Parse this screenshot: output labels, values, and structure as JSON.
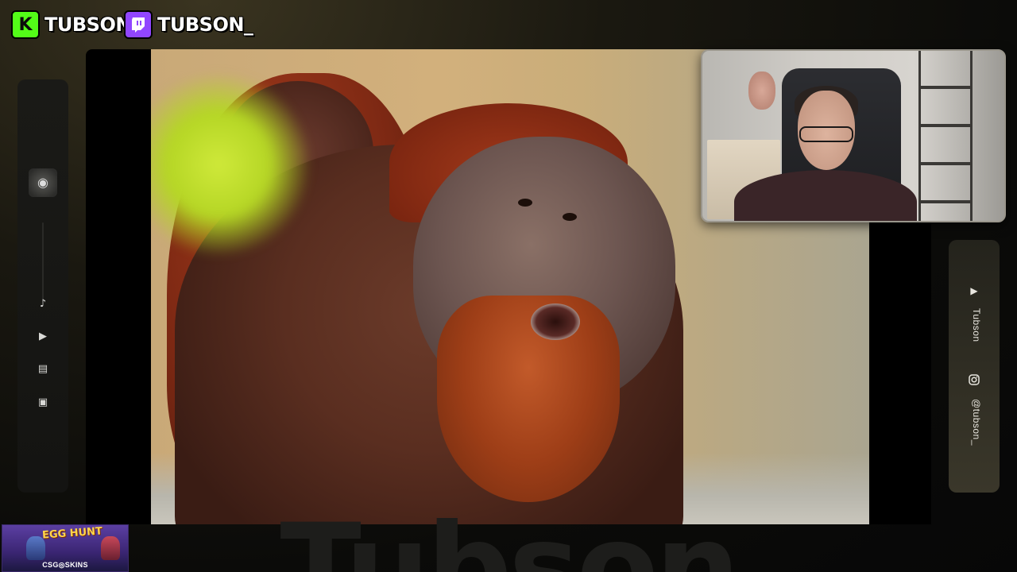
{
  "socials": {
    "kick": {
      "icon": "kick-icon",
      "letter": "K",
      "handle": "TUBSON",
      "color": "#53fc18"
    },
    "twitch": {
      "icon": "twitch-icon",
      "handle": "TUBSON_",
      "color": "#9146ff"
    }
  },
  "left_sidebar": {
    "items": [
      {
        "icon": "music-note-icon",
        "glyph": "♪"
      },
      {
        "icon": "video-play-icon",
        "glyph": "▶"
      },
      {
        "icon": "clapperboard-icon",
        "glyph": "▤"
      },
      {
        "icon": "image-icon",
        "glyph": "▣"
      }
    ]
  },
  "right_sidebar": {
    "youtube_name": "Tubson",
    "instagram_handle": "@tubson_"
  },
  "stream": {
    "watermark": "Tubson"
  },
  "sponsor": {
    "title": "EGG HUNT",
    "brand": "CSG◎SKINS"
  }
}
